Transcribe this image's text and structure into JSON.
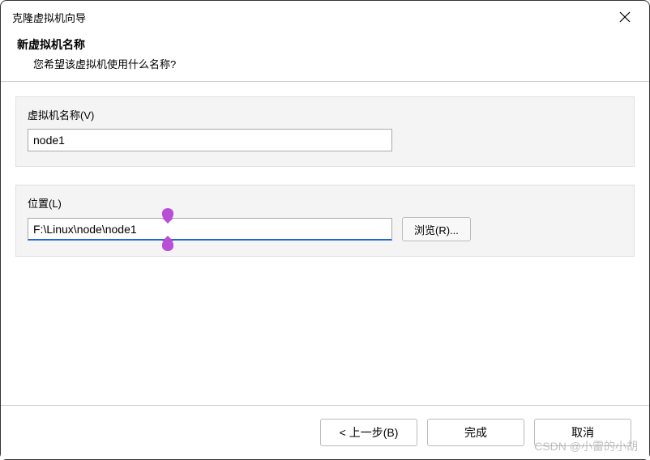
{
  "window": {
    "title": "克隆虚拟机向导"
  },
  "header": {
    "title": "新虚拟机名称",
    "subtitle": "您希望该虚拟机使用什么名称?"
  },
  "fields": {
    "vm_name": {
      "label": "虚拟机名称(V)",
      "value": "node1"
    },
    "location": {
      "label": "位置(L)",
      "value": "F:\\Linux\\node\\node1",
      "browse_label": "浏览(R)..."
    }
  },
  "buttons": {
    "back": "< 上一步(B)",
    "finish": "完成",
    "cancel": "取消"
  },
  "watermark": "CSDN @小雷的小胡"
}
